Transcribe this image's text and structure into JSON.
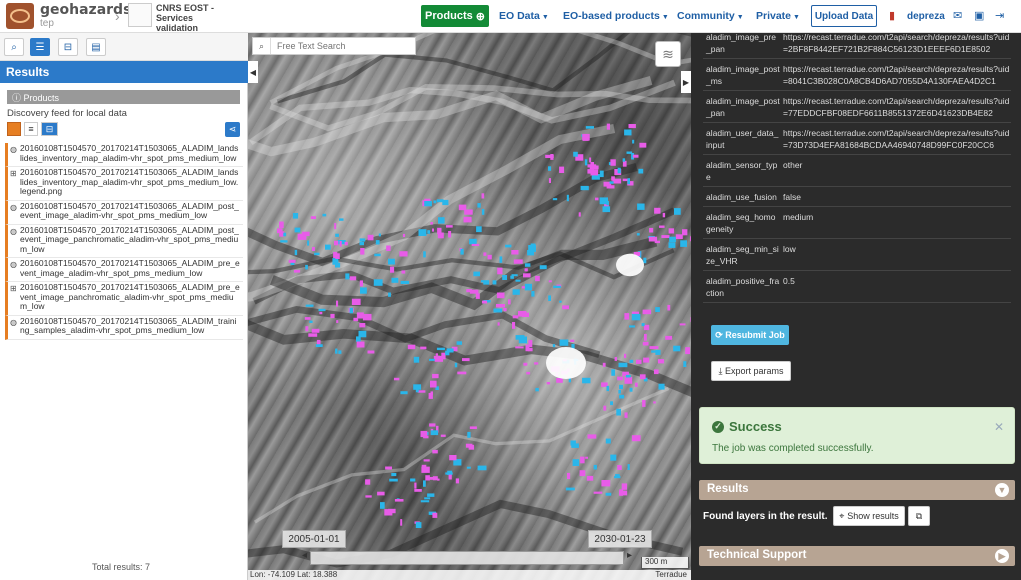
{
  "navbar": {
    "brand_name": "geohazards",
    "brand_sub": "tep",
    "community_name": "CNRS EOST - Services validation",
    "products_label": "Products",
    "links": [
      "EO Data",
      "EO-based products",
      "Community",
      "Private"
    ],
    "upload_label": "Upload Data",
    "user_name": "depreza"
  },
  "left_panel": {
    "results_title": "Results",
    "products_label": "Products",
    "feed_text": "Discovery feed for local data",
    "items": [
      {
        "icon": "globe-icon",
        "title": "20160108T1504570_20170214T1503065_ALADIM_landslides_inventory_map_aladim-vhr_spot_pms_medium_low"
      },
      {
        "icon": "network-icon",
        "title": "20160108T1504570_20170214T1503065_ALADIM_landslides_inventory_map_aladim-vhr_spot_pms_medium_low.legend.png"
      },
      {
        "icon": "globe-icon",
        "title": "20160108T1504570_20170214T1503065_ALADIM_post_event_image_aladim-vhr_spot_pms_medium_low"
      },
      {
        "icon": "globe-icon",
        "title": "20160108T1504570_20170214T1503065_ALADIM_post_event_image_panchromatic_aladim-vhr_spot_pms_medium_low"
      },
      {
        "icon": "globe-icon",
        "title": "20160108T1504570_20170214T1503065_ALADIM_pre_event_image_aladim-vhr_spot_pms_medium_low"
      },
      {
        "icon": "network-icon",
        "title": "20160108T1504570_20170214T1503065_ALADIM_pre_event_image_panchromatic_aladim-vhr_spot_pms_medium_low"
      },
      {
        "icon": "globe-icon",
        "title": "20160108T1504570_20170214T1503065_ALADIM_training_samples_aladim-vhr_spot_pms_medium_low"
      }
    ],
    "total_results": "Total results: 7"
  },
  "map": {
    "search_placeholder": "Free Text Search",
    "date_start": "2005-01-01",
    "date_end": "2030-01-23",
    "scale_label": "300 m",
    "coords": "Lon: -74.109 Lat: 18.388",
    "attribution": "Terradue"
  },
  "right_panel": {
    "params": [
      {
        "key": "aladim_image_pre_pan",
        "value": "https://recast.terradue.com/t2api/search/depreza/results?uid=2BF8F8442EF721B2F884C56123D1EEEF6D1E8502"
      },
      {
        "key": "aladim_image_post_ms",
        "value": "https://recast.terradue.com/t2api/search/depreza/results?uid=8041C3B028C0A8CB4D6AD7055D4A130FAEA4D2C1"
      },
      {
        "key": "aladim_image_post_pan",
        "value": "https://recast.terradue.com/t2api/search/depreza/results?uid=77EDDCFBF08EDF6611B8551372E6D41623DB4E82"
      },
      {
        "key": "aladim_user_data_input",
        "value": "https://recast.terradue.com/t2api/search/depreza/results?uid=73D73D4EFA81684BCDAA46940748D99FC0F20CC6"
      },
      {
        "key": "aladim_sensor_type",
        "value": "other"
      },
      {
        "key": "aladim_use_fusion",
        "value": "false"
      },
      {
        "key": "aladim_seg_homogeneity",
        "value": "medium"
      },
      {
        "key": "aladim_seg_min_size_VHR",
        "value": "low"
      },
      {
        "key": "aladim_positive_fraction",
        "value": "0.5"
      }
    ],
    "resubmit_label": "Resubmit Job",
    "export_label": "Export params",
    "alert_title": "Success",
    "alert_message": "The job was completed successfully.",
    "results_header": "Results",
    "found_text": "Found layers in the result.",
    "show_results_label": "Show results",
    "support_header": "Technical Support"
  },
  "colors": {
    "brand_green": "#138a36",
    "link_blue": "#1f5fa5",
    "panel_blue": "#2c7ac9",
    "item_orange": "#e67e22",
    "section_tan": "#b7a493",
    "overlay_magenta": "#e85ce8",
    "overlay_cyan": "#2ab6ea"
  }
}
